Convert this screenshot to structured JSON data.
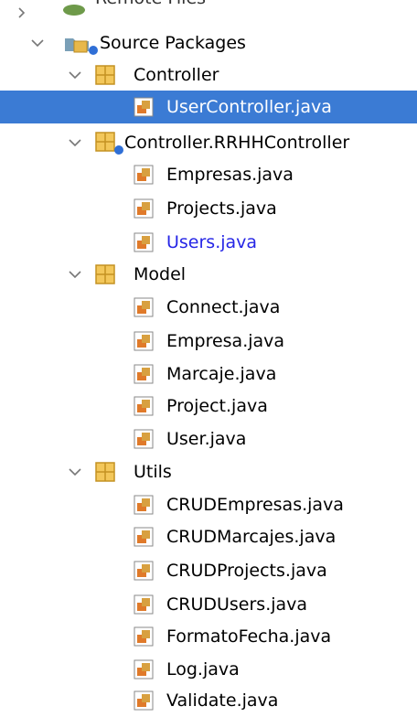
{
  "tree": {
    "partial_top": {
      "label": "Remote Files"
    },
    "nodes": [
      {
        "label": "Source Packages",
        "kind": "source-root",
        "expanded": true
      },
      {
        "label": "Controller",
        "kind": "package",
        "expanded": true
      },
      {
        "label": "UserController.java",
        "kind": "java-file",
        "selected": true
      },
      {
        "label": "Controller.RRHHController",
        "kind": "package-badged",
        "expanded": true
      },
      {
        "label": "Empresas.java",
        "kind": "java-file"
      },
      {
        "label": "Projects.java",
        "kind": "java-file"
      },
      {
        "label": "Users.java",
        "kind": "java-file",
        "highlight": true
      },
      {
        "label": "Model",
        "kind": "package",
        "expanded": true
      },
      {
        "label": "Connect.java",
        "kind": "java-file"
      },
      {
        "label": "Empresa.java",
        "kind": "java-file"
      },
      {
        "label": "Marcaje.java",
        "kind": "java-file"
      },
      {
        "label": "Project.java",
        "kind": "java-file"
      },
      {
        "label": "User.java",
        "kind": "java-file"
      },
      {
        "label": "Utils",
        "kind": "package",
        "expanded": true
      },
      {
        "label": "CRUDEmpresas.java",
        "kind": "java-file"
      },
      {
        "label": "CRUDMarcajes.java",
        "kind": "java-file"
      },
      {
        "label": "CRUDProjects.java",
        "kind": "java-file"
      },
      {
        "label": "CRUDUsers.java",
        "kind": "java-file"
      },
      {
        "label": "FormatoFecha.java",
        "kind": "java-file"
      },
      {
        "label": "Log.java",
        "kind": "java-file"
      },
      {
        "label": "Validate.java",
        "kind": "java-file"
      }
    ]
  },
  "colors": {
    "selection": "#3b7bd4",
    "link_text": "#2626e6",
    "package_icon": "#e8b84a"
  }
}
